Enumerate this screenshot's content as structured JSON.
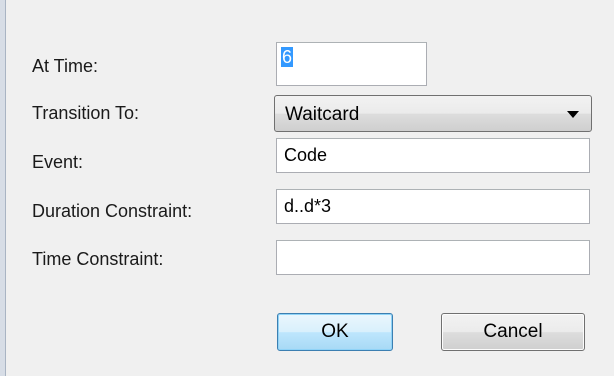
{
  "form": {
    "at_time": {
      "label": "At Time:",
      "value": "6"
    },
    "transition_to": {
      "label": "Transition To:",
      "selected": "Waitcard"
    },
    "event": {
      "label": "Event:",
      "value": "Code"
    },
    "duration_constraint": {
      "label": "Duration Constraint:",
      "value": "d..d*3"
    },
    "time_constraint": {
      "label": "Time Constraint:",
      "value": ""
    }
  },
  "buttons": {
    "ok_label": "OK",
    "cancel_label": "Cancel"
  },
  "icons": {
    "dropdown": "chevron-down-icon"
  }
}
